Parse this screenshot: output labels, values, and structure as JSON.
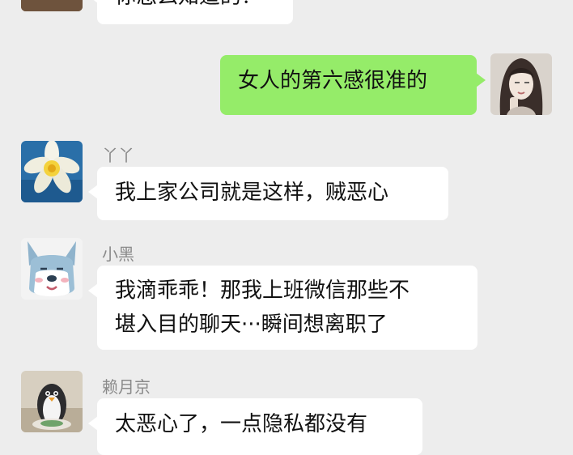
{
  "chat": {
    "messages": [
      {
        "side": "left",
        "sender": "",
        "lines": [
          "你怎么知道的？"
        ],
        "avatar": "partial-avatar-icon"
      },
      {
        "side": "right",
        "sender": "",
        "lines": [
          "女人的第六感很准的"
        ],
        "avatar": "woman-avatar-icon"
      },
      {
        "side": "left",
        "sender": "丫丫",
        "lines": [
          "我上家公司就是这样，贼恶心"
        ],
        "avatar": "daffodil-avatar-icon"
      },
      {
        "side": "left",
        "sender": "小黑",
        "lines": [
          "我滴乖乖！那我上班微信那些不",
          "堪入目的聊天···瞬间想离职了"
        ],
        "avatar": "dog-avatar-icon"
      },
      {
        "side": "left",
        "sender": "赖月京",
        "lines": [
          "太恶心了，一点隐私都没有"
        ],
        "avatar": "penguin-avatar-icon"
      }
    ]
  },
  "colors": {
    "background": "#ededed",
    "incoming_bubble": "#ffffff",
    "outgoing_bubble": "#95ec69",
    "sender_name": "#8a8a8a"
  }
}
